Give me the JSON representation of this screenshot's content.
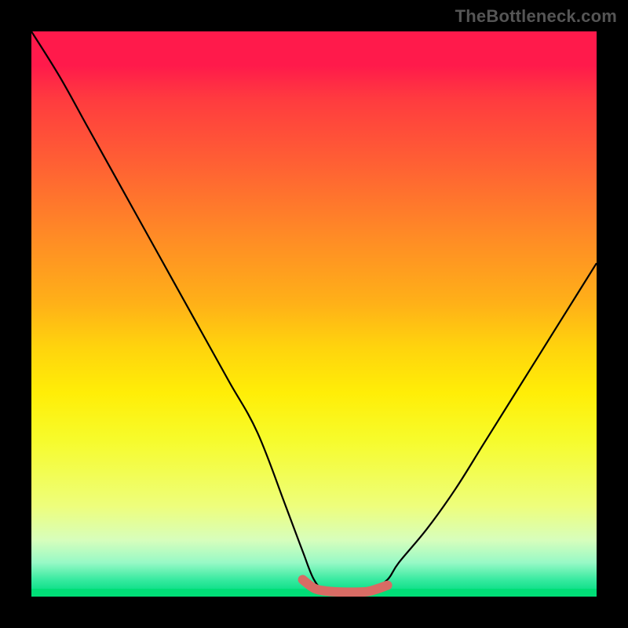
{
  "watermark": "TheBottleneck.com",
  "colors": {
    "page_bg": "#000000",
    "gradient_top": "#ff1a4b",
    "gradient_bottom": "#02dd7b",
    "curve": "#000000",
    "marker": "#d86b64"
  },
  "chart_data": {
    "type": "line",
    "title": "",
    "xlabel": "",
    "ylabel": "",
    "xlim": [
      0,
      100
    ],
    "ylim": [
      0,
      100
    ],
    "grid": false,
    "legend": false,
    "series": [
      {
        "name": "bottleneck-curve",
        "x": [
          0,
          5,
          10,
          15,
          20,
          25,
          30,
          35,
          40,
          45,
          48,
          50,
          52,
          55,
          58,
          60,
          63,
          65,
          70,
          75,
          80,
          85,
          90,
          95,
          100
        ],
        "values": [
          100,
          92,
          83,
          74,
          65,
          56,
          47,
          38,
          29,
          16,
          8,
          3,
          1,
          0.5,
          0.5,
          1,
          3,
          6,
          12,
          19,
          27,
          35,
          43,
          51,
          59
        ]
      },
      {
        "name": "ideal-zone-marker",
        "x": [
          48,
          50,
          52,
          55,
          58,
          60,
          63
        ],
        "values": [
          3,
          1.5,
          1,
          0.8,
          0.8,
          1,
          2
        ]
      }
    ],
    "annotations": []
  }
}
